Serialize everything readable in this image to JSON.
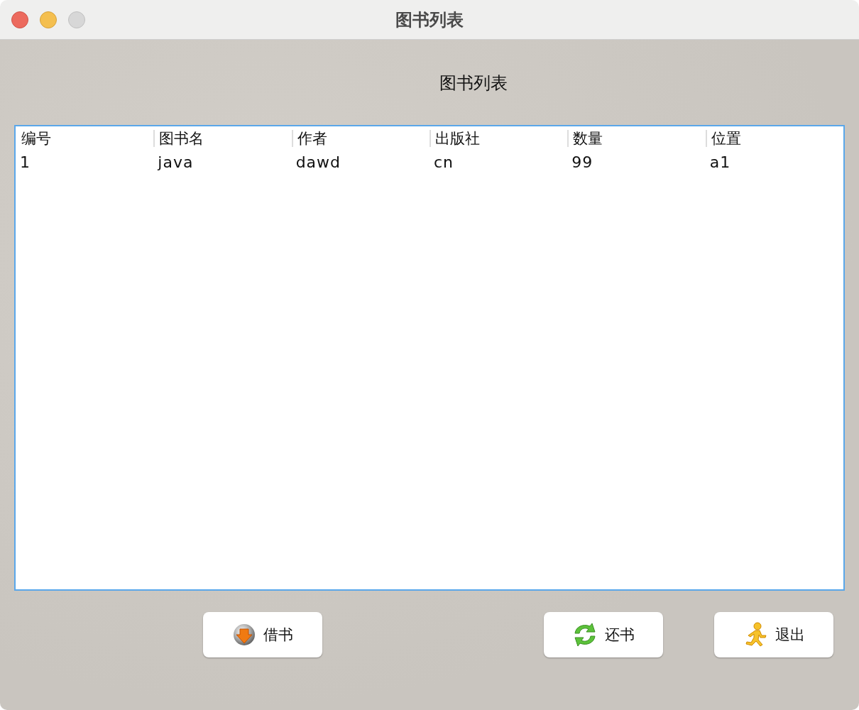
{
  "window": {
    "title": "图书列表"
  },
  "heading": "图书列表",
  "table": {
    "columns": [
      "编号",
      "图书名",
      "作者",
      "出版社",
      "数量",
      "位置"
    ],
    "rows": [
      [
        "1",
        "java",
        "dawd",
        "cn",
        "99",
        "a1"
      ]
    ]
  },
  "buttons": [
    {
      "label": "借书",
      "kind": "download"
    },
    {
      "label": "还书",
      "kind": "refresh"
    },
    {
      "label": "退出",
      "kind": "runner"
    }
  ]
}
